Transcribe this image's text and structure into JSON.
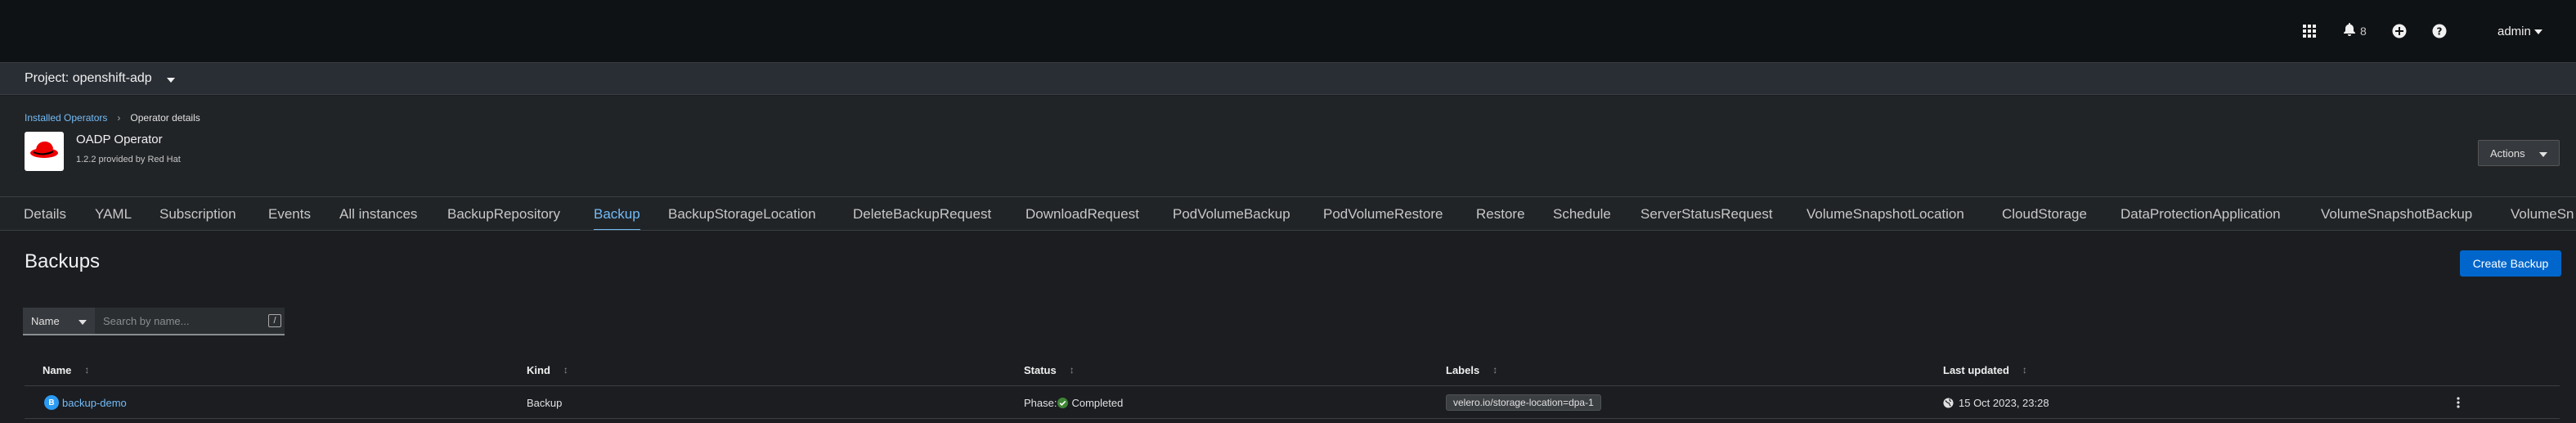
{
  "masthead": {
    "notifications_count": "8",
    "user_label": "admin"
  },
  "project_bar": {
    "label": "Project: openshift-adp"
  },
  "breadcrumb": {
    "link": "Installed Operators",
    "current": "Operator details"
  },
  "operator": {
    "name": "OADP Operator",
    "subtitle": "1.2.2 provided by Red Hat"
  },
  "actions_label": "Actions",
  "tabs": [
    {
      "label": "Details"
    },
    {
      "label": "YAML"
    },
    {
      "label": "Subscription"
    },
    {
      "label": "Events"
    },
    {
      "label": "All instances"
    },
    {
      "label": "BackupRepository"
    },
    {
      "label": "Backup"
    },
    {
      "label": "BackupStorageLocation"
    },
    {
      "label": "DeleteBackupRequest"
    },
    {
      "label": "DownloadRequest"
    },
    {
      "label": "PodVolumeBackup"
    },
    {
      "label": "PodVolumeRestore"
    },
    {
      "label": "Restore"
    },
    {
      "label": "Schedule"
    },
    {
      "label": "ServerStatusRequest"
    },
    {
      "label": "VolumeSnapshotLocation"
    },
    {
      "label": "CloudStorage"
    },
    {
      "label": "DataProtectionApplication"
    },
    {
      "label": "VolumeSnapshotBackup"
    },
    {
      "label": "VolumeSn"
    }
  ],
  "active_tab": "Backup",
  "page_title": "Backups",
  "create_button": "Create Backup",
  "filter": {
    "select_value": "Name",
    "placeholder": "Search by name...",
    "shortcut": "/"
  },
  "table": {
    "columns": [
      "Name",
      "Kind",
      "Status",
      "Labels",
      "Last updated"
    ],
    "rows": [
      {
        "badge": "B",
        "name": "backup-demo",
        "kind": "Backup",
        "status_prefix": "Phase:",
        "status": "Completed",
        "label": "velero.io/storage-location=dpa-1",
        "last_updated": "15 Oct 2023, 23:28"
      }
    ]
  },
  "colors": {
    "accent": "#73bcf7",
    "primary_button": "#0066cc",
    "success": "#3e8635"
  }
}
